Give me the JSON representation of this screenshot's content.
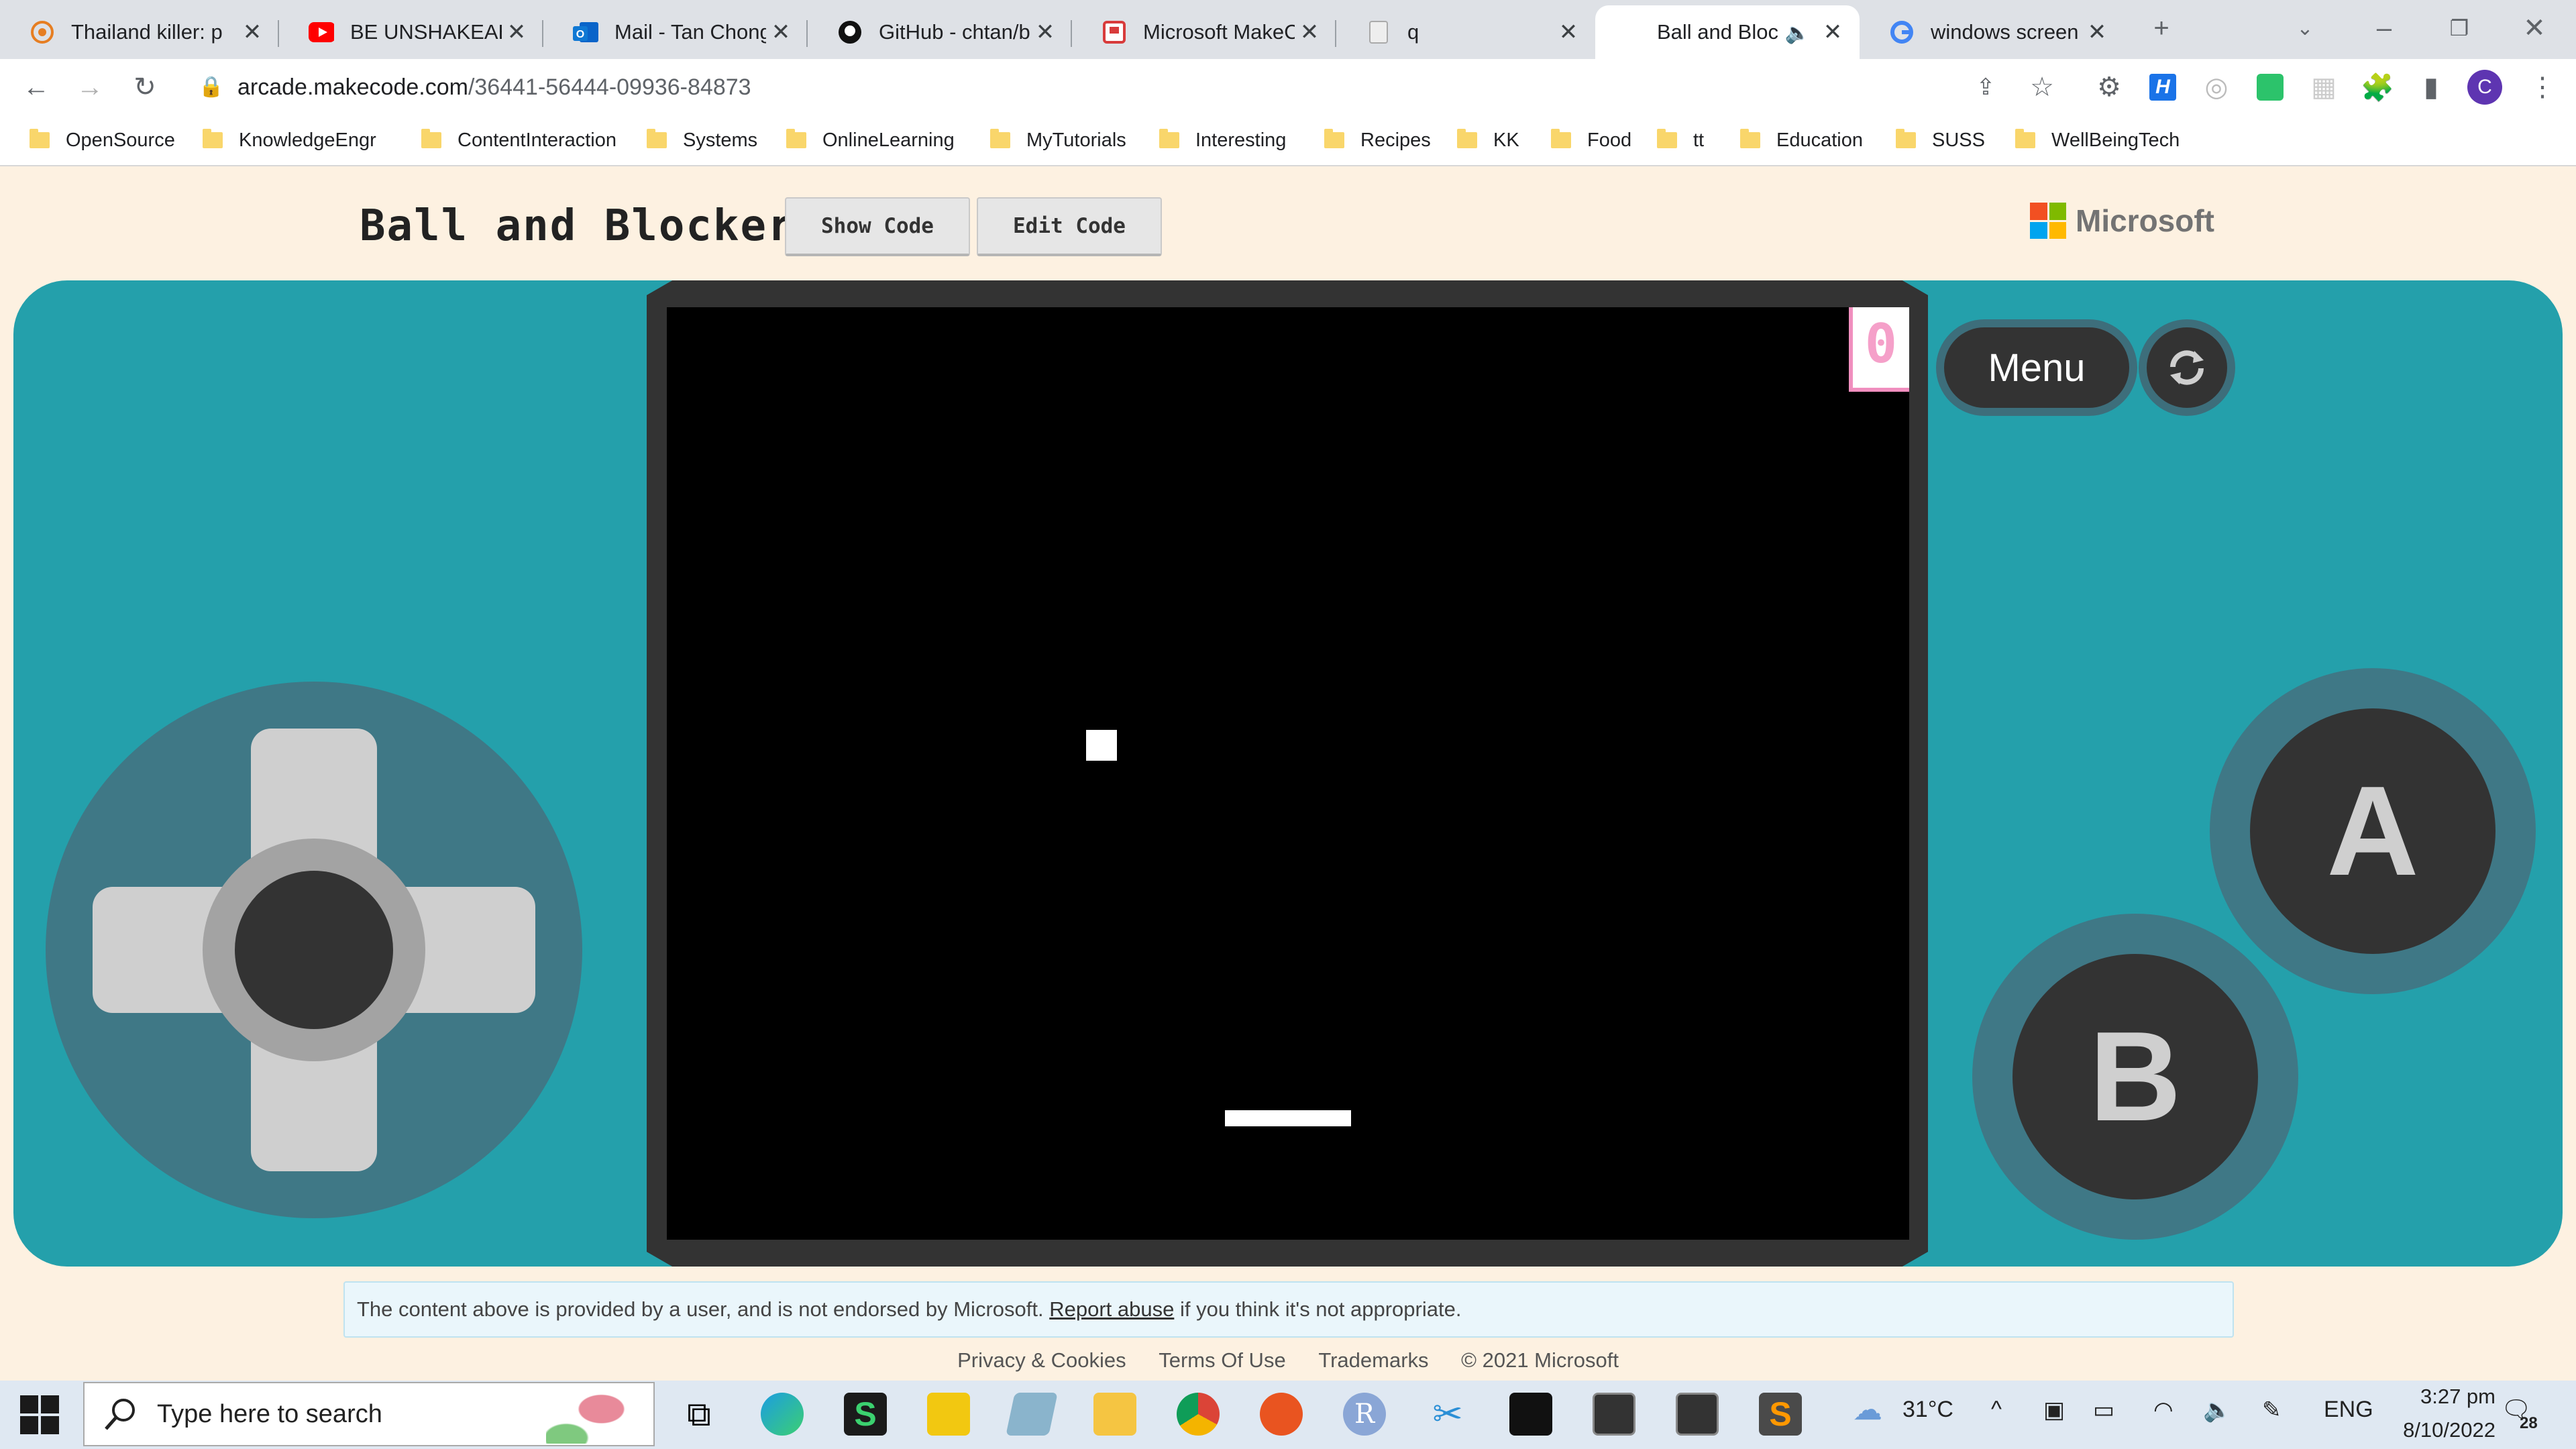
{
  "browser": {
    "tabs": [
      {
        "title": "Thailand killer: po",
        "icon": "orange-swirl-icon"
      },
      {
        "title": "BE UNSHAKEABLE",
        "icon": "youtube-icon"
      },
      {
        "title": "Mail - Tan Chong",
        "icon": "outlook-icon"
      },
      {
        "title": "GitHub - chtan/b",
        "icon": "github-icon"
      },
      {
        "title": "Microsoft MakeC",
        "icon": "makecode-icon"
      },
      {
        "title": "q",
        "icon": "document-icon"
      },
      {
        "title": "Ball and Bloc",
        "icon": "speaker-icon",
        "active": true
      },
      {
        "title": "windows screen c",
        "icon": "google-icon"
      }
    ],
    "url_domain": "arcade.makecode.com",
    "url_path": "/36441-56444-09936-84873",
    "profile_initial": "C",
    "bookmarks": [
      "OpenSource",
      "KnowledgeEngr",
      "ContentInteraction",
      "Systems",
      "OnlineLearning",
      "MyTutorials",
      "Interesting",
      "Recipes",
      "KK",
      "Food",
      "tt",
      "Education",
      "SUSS",
      "WellBeingTech"
    ]
  },
  "page": {
    "title": "Ball and Blocker",
    "show_code_label": "Show Code",
    "edit_code_label": "Edit Code",
    "brand": "Microsoft",
    "brand_colors": [
      "#f25022",
      "#7fba00",
      "#00a4ef",
      "#ffb900"
    ]
  },
  "simulator": {
    "score": "0",
    "menu_label": "Menu",
    "button_a": "A",
    "button_b": "B",
    "body_color": "#24a0ab",
    "ball": {
      "col": 0.35,
      "row": 0.47
    },
    "paddle": {
      "col": 0.5,
      "row": 0.87
    }
  },
  "footer": {
    "notice_before": "The content above is provided by a user, and is not endorsed by Microsoft.",
    "notice_link": "Report abuse",
    "notice_after": "if you think it's not appropriate.",
    "links": [
      "Privacy & Cookies",
      "Terms Of Use",
      "Trademarks",
      "© 2021 Microsoft"
    ]
  },
  "taskbar": {
    "search_placeholder": "Type here to search",
    "weather": "31°C",
    "language": "ENG",
    "time": "3:27 pm",
    "date": "8/10/2022",
    "notifications": "28"
  }
}
